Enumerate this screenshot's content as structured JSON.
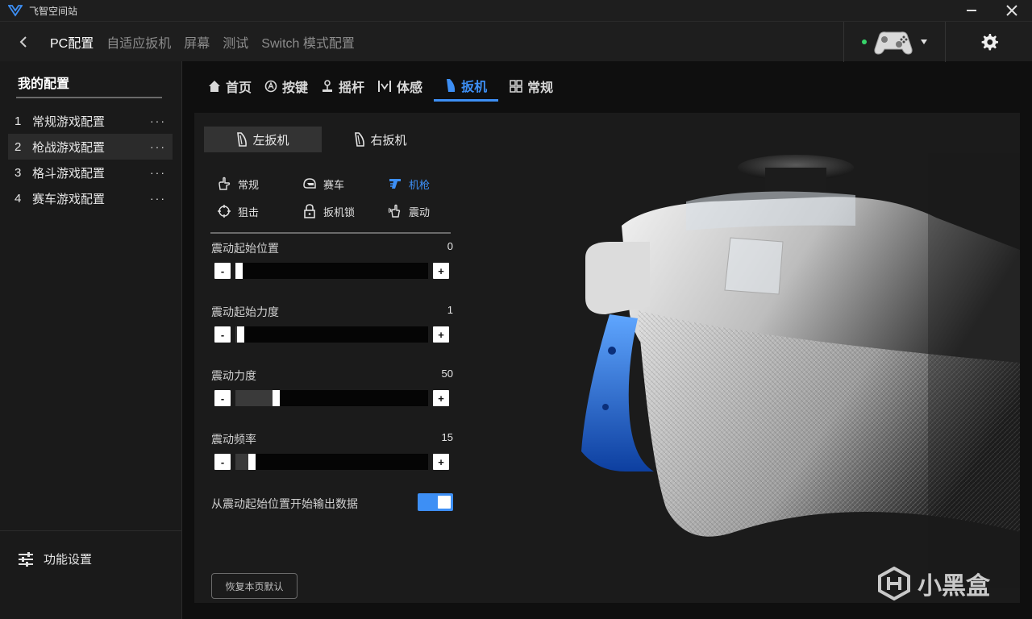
{
  "window": {
    "title": "飞智空间站"
  },
  "topnav": {
    "items": [
      {
        "label": "PC配置",
        "active": true
      },
      {
        "label": "自适应扳机",
        "active": false
      },
      {
        "label": "屏幕",
        "active": false
      },
      {
        "label": "测试",
        "active": false
      },
      {
        "label": "Switch 模式配置",
        "active": false
      }
    ],
    "device_status_color": "#37d46a"
  },
  "sidebar": {
    "title": "我的配置",
    "items": [
      {
        "num": "1",
        "label": "常规游戏配置",
        "more": "···"
      },
      {
        "num": "2",
        "label": "枪战游戏配置",
        "more": "···",
        "active": true
      },
      {
        "num": "3",
        "label": "格斗游戏配置",
        "more": "···"
      },
      {
        "num": "4",
        "label": "赛车游戏配置",
        "more": "···"
      }
    ],
    "footer_label": "功能设置"
  },
  "section_tabs": [
    {
      "label": "首页",
      "icon": "home-icon"
    },
    {
      "label": "按键",
      "icon": "button-a-icon"
    },
    {
      "label": "摇杆",
      "icon": "joystick-icon"
    },
    {
      "label": "体感",
      "icon": "motion-icon"
    },
    {
      "label": "扳机",
      "icon": "trigger-icon",
      "active": true
    },
    {
      "label": "常规",
      "icon": "grid-icon"
    }
  ],
  "trigger_tabs": [
    {
      "label": "左扳机",
      "active": true
    },
    {
      "label": "右扳机",
      "active": false
    }
  ],
  "modes": [
    {
      "label": "常规",
      "icon": "hand-icon"
    },
    {
      "label": "赛车",
      "icon": "racing-helmet-icon"
    },
    {
      "label": "机枪",
      "icon": "machine-gun-icon",
      "active": true
    },
    {
      "label": "狙击",
      "icon": "crosshair-icon"
    },
    {
      "label": "扳机锁",
      "icon": "lock-icon"
    },
    {
      "label": "震动",
      "icon": "vibration-icon"
    }
  ],
  "sliders": [
    {
      "label": "震动起始位置",
      "value": "0",
      "fraction": 0.0
    },
    {
      "label": "震动起始力度",
      "value": "1",
      "fraction": 0.01
    },
    {
      "label": "震动力度",
      "value": "50",
      "fraction": 0.2
    },
    {
      "label": "震动频率",
      "value": "15",
      "fraction": 0.07
    }
  ],
  "slider_buttons": {
    "minus": "-",
    "plus": "+"
  },
  "toggle": {
    "label": "从震动起始位置开始输出数据",
    "on": true
  },
  "reset_label": "恢复本页默认",
  "watermark": "小黑盒",
  "colors": {
    "accent": "#3d8ff5",
    "background": "#0f0f0f",
    "panel": "#1b1b1b"
  }
}
